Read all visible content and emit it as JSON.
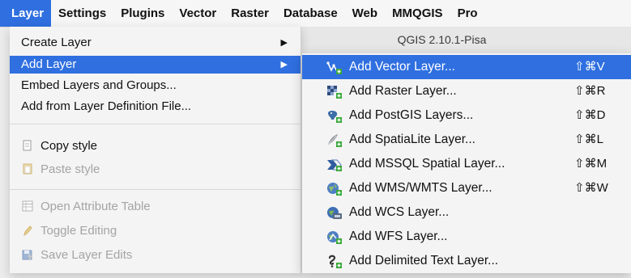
{
  "menubar": {
    "items": [
      "Layer",
      "Settings",
      "Plugins",
      "Vector",
      "Raster",
      "Database",
      "Web",
      "MMQGIS",
      "Pro"
    ]
  },
  "title_strip": "QGIS 2.10.1-Pisa",
  "layer_menu": {
    "items": [
      {
        "label": "Create Layer",
        "submenu_arrow": "▶"
      },
      {
        "label": "Add Layer",
        "submenu_arrow": "▶"
      },
      {
        "label": "Embed Layers and Groups..."
      },
      {
        "label": "Add from Layer Definition File..."
      },
      {
        "label": "Copy style"
      },
      {
        "label": "Paste style"
      },
      {
        "label": "Open Attribute Table"
      },
      {
        "label": "Toggle Editing"
      },
      {
        "label": "Save Layer Edits"
      }
    ]
  },
  "add_layer_submenu": {
    "items": [
      {
        "label": "Add Vector Layer...",
        "shortcut": "⇧⌘V",
        "icon": "vector-layer-icon"
      },
      {
        "label": "Add Raster Layer...",
        "shortcut": "⇧⌘R",
        "icon": "raster-layer-icon"
      },
      {
        "label": "Add PostGIS Layers...",
        "shortcut": "⇧⌘D",
        "icon": "postgis-icon"
      },
      {
        "label": "Add SpatiaLite Layer...",
        "shortcut": "⇧⌘L",
        "icon": "spatialite-icon"
      },
      {
        "label": "Add MSSQL Spatial Layer...",
        "shortcut": "⇧⌘M",
        "icon": "mssql-icon"
      },
      {
        "label": "Add WMS/WMTS Layer...",
        "shortcut": "⇧⌘W",
        "icon": "wms-icon"
      },
      {
        "label": "Add WCS Layer...",
        "shortcut": "",
        "icon": "wcs-icon"
      },
      {
        "label": "Add WFS Layer...",
        "shortcut": "",
        "icon": "wfs-icon"
      },
      {
        "label": "Add Delimited Text Layer...",
        "shortcut": "",
        "icon": "delimited-text-icon"
      }
    ]
  },
  "colors": {
    "highlight": "#2f6fe0",
    "menu_bg": "#f4f4f4",
    "disabled_text": "#a4a4a4",
    "badge_green": "#3aa83a"
  }
}
